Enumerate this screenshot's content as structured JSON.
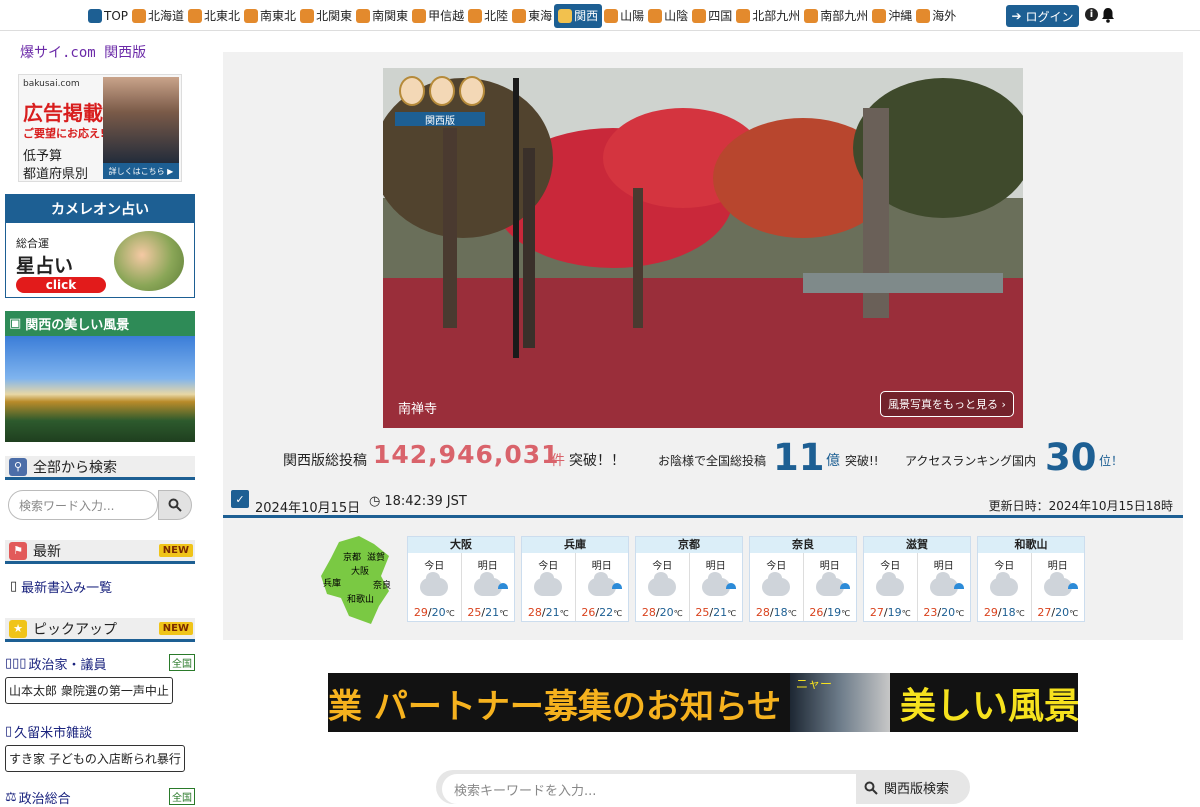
{
  "nav": {
    "items": [
      {
        "label": "TOP",
        "icon": "home-icon"
      },
      {
        "label": "北海道",
        "icon": "region-icon"
      },
      {
        "label": "北東北",
        "icon": "region-icon"
      },
      {
        "label": "南東北",
        "icon": "region-icon"
      },
      {
        "label": "北関東",
        "icon": "region-icon"
      },
      {
        "label": "南関東",
        "icon": "region-icon"
      },
      {
        "label": "甲信越",
        "icon": "region-icon"
      },
      {
        "label": "北陸",
        "icon": "region-icon"
      },
      {
        "label": "東海",
        "icon": "region-icon"
      },
      {
        "label": "関西",
        "icon": "region-icon",
        "active": true
      },
      {
        "label": "山陽",
        "icon": "region-icon"
      },
      {
        "label": "山陰",
        "icon": "region-icon"
      },
      {
        "label": "四国",
        "icon": "region-icon"
      },
      {
        "label": "北部九州",
        "icon": "region-icon"
      },
      {
        "label": "南部九州",
        "icon": "region-icon"
      },
      {
        "label": "沖縄",
        "icon": "region-icon"
      },
      {
        "label": "海外",
        "icon": "region-icon"
      }
    ],
    "login": "ログイン"
  },
  "sidebar": {
    "site_title": "爆サイ.com 関西版",
    "ad1": {
      "brand": "bakusai.com",
      "big": "広告掲載",
      "red": "ご要望にお応え!",
      "line1": "低予算",
      "line2": "都道府県別",
      "more": "詳しくはこちら ▶"
    },
    "ad2": {
      "title": "カメレオン占い",
      "sub": "総合運",
      "star": "星占い",
      "click": "click"
    },
    "scenery_title": "関西の美しい風景",
    "search_title": "全部から検索",
    "search_placeholder": "検索ワード入力...",
    "latest_title": "最新",
    "latest_badge": "NEW",
    "latest_link": "最新書込み一覧",
    "pickup_title": "ピックアップ",
    "pickup_badge": "NEW",
    "pickups": [
      {
        "title": "政治家・議員",
        "tag": "全国",
        "bubble": "山本太郎 衆院選の第一声中止"
      },
      {
        "title": "久留米市雑談",
        "tag": "",
        "bubble": "すき家 子どもの入店断られ暴行"
      },
      {
        "title": "政治総合",
        "tag": "全国",
        "bubble": ""
      }
    ]
  },
  "hero": {
    "badge": "関西版",
    "caption": "南禅寺",
    "more": "風景写真をもっと見る ›"
  },
  "stats": {
    "s1_label": "関西版総投稿",
    "s1_value": "142,946,031",
    "s1_unit": "件",
    "s1_tail": "突破！！",
    "s2_label": "お陰様で全国総投稿",
    "s2_value": "11",
    "s2_unit": "億",
    "s2_tail": "突破!!",
    "s3_label": "アクセスランキング国内",
    "s3_value": "30",
    "s3_unit": "位！"
  },
  "datebar": {
    "date": "2024年10月15日",
    "time": "18:42:39",
    "tz": "JST",
    "updated": "更新日時：2024年10月15日18時"
  },
  "weather": {
    "map_labels": [
      "京都",
      "滋賀",
      "大阪",
      "兵庫",
      "奈良",
      "和歌山"
    ],
    "today_label": "今日",
    "tomorrow_label": "明日",
    "unit": "℃",
    "cities": [
      {
        "name": "大阪",
        "today": {
          "hi": "29",
          "lo": "20"
        },
        "tomorrow": {
          "hi": "25",
          "lo": "21"
        }
      },
      {
        "name": "兵庫",
        "today": {
          "hi": "28",
          "lo": "21"
        },
        "tomorrow": {
          "hi": "26",
          "lo": "22"
        }
      },
      {
        "name": "京都",
        "today": {
          "hi": "28",
          "lo": "20"
        },
        "tomorrow": {
          "hi": "25",
          "lo": "21"
        }
      },
      {
        "name": "奈良",
        "today": {
          "hi": "28",
          "lo": "18"
        },
        "tomorrow": {
          "hi": "26",
          "lo": "19"
        }
      },
      {
        "name": "滋賀",
        "today": {
          "hi": "27",
          "lo": "19"
        },
        "tomorrow": {
          "hi": "23",
          "lo": "20"
        }
      },
      {
        "name": "和歌山",
        "today": {
          "hi": "29",
          "lo": "18"
        },
        "tomorrow": {
          "hi": "27",
          "lo": "20"
        }
      }
    ]
  },
  "banner": {
    "text1": "業 パートナー募集のお知らせ",
    "nya": "ニャー",
    "text2": "美しい風景"
  },
  "bottom_search": {
    "placeholder": "検索キーワードを入力...",
    "button": "関西版検索"
  },
  "colors": {
    "accent": "#1d5f93",
    "red": "#d9636b",
    "green": "#2e8b57"
  }
}
